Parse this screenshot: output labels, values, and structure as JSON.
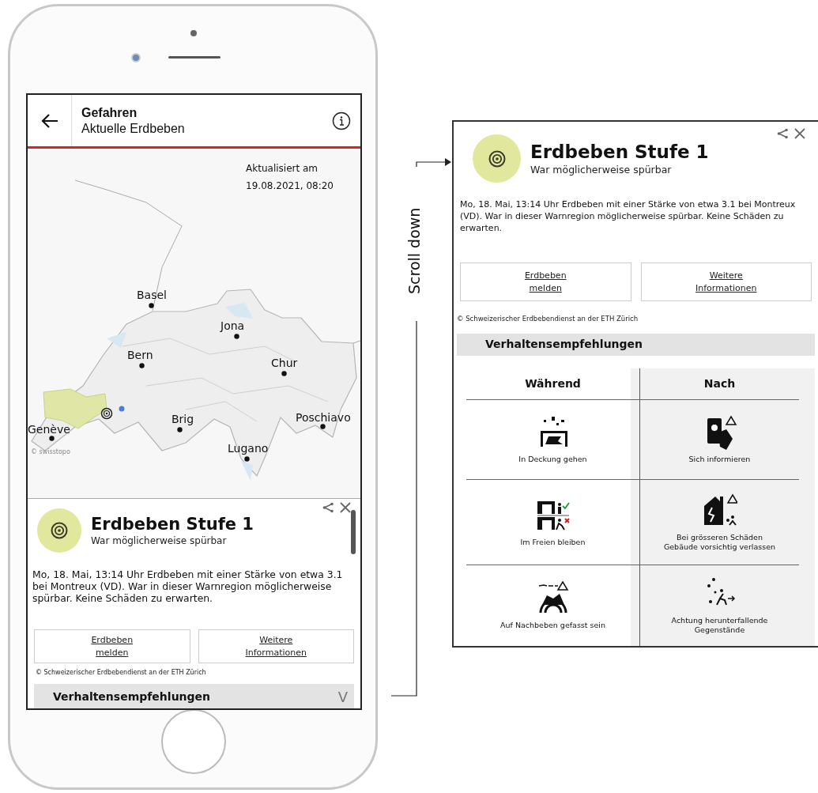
{
  "phone": {
    "header": {
      "title": "Gefahren",
      "subtitle": "Aktuelle Erdbeben"
    },
    "map": {
      "updated_label": "Aktualisiert am",
      "updated_time": "19.08.2021, 08:20",
      "attribution": "© swisstopo",
      "cities": [
        "Basel",
        "Jona",
        "Bern",
        "Chur",
        "Brig",
        "Poschiavo",
        "Lugano",
        "Genève"
      ]
    },
    "card": {
      "title": "Erdbeben Stufe 1",
      "subtitle": "War möglicherweise spürbar",
      "body": "Mo, 18. Mai, 13:14 Uhr Erdbeben mit einer Stärke von etwa 3.1 bei Montreux (VD). War in dieser Warnregion möglicherweise spürbar. Keine Schäden zu erwarten.",
      "buttons": [
        [
          "Erdbeben",
          "melden"
        ],
        [
          "Weitere",
          "Informationen"
        ]
      ],
      "credit": "© Schweizerischer Erdbebendienst an der ETH Zürich",
      "section": "Verhaltensempfehlungen",
      "toggle": "V"
    }
  },
  "annotation": {
    "label": "Scroll down"
  },
  "detail_panel": {
    "card": {
      "title": "Erdbeben Stufe 1",
      "subtitle": "War möglicherweise spürbar",
      "body": "Mo, 18. Mai, 13:14 Uhr Erdbeben mit einer Stärke von etwa 3.1 bei Montreux (VD). War in dieser Warnregion möglicherweise spürbar. Keine Schäden zu erwarten.",
      "buttons": [
        [
          "Erdbeben",
          "melden"
        ],
        [
          "Weitere",
          "Informationen"
        ]
      ],
      "credit": "© Schweizerischer Erdbebendienst an der ETH Zürich",
      "section": "Verhaltensempfehlungen"
    },
    "recommendations": {
      "columns": [
        "Während",
        "Nach"
      ],
      "rows": [
        [
          {
            "kind": "cover",
            "label": "In Deckung gehen"
          },
          {
            "kind": "inform",
            "label": "Sich informieren"
          }
        ],
        [
          {
            "kind": "outside",
            "label": "Im Freien bleiben"
          },
          {
            "kind": "leave",
            "label": "Bei grösseren Schäden Gebäude vorsichtig verlassen"
          }
        ],
        [
          {
            "kind": "aftershock",
            "label": "Auf Nachbeben gefasst sein"
          },
          {
            "kind": "falling",
            "label": "Achtung herunterfallende Gegenstände"
          }
        ]
      ]
    }
  }
}
